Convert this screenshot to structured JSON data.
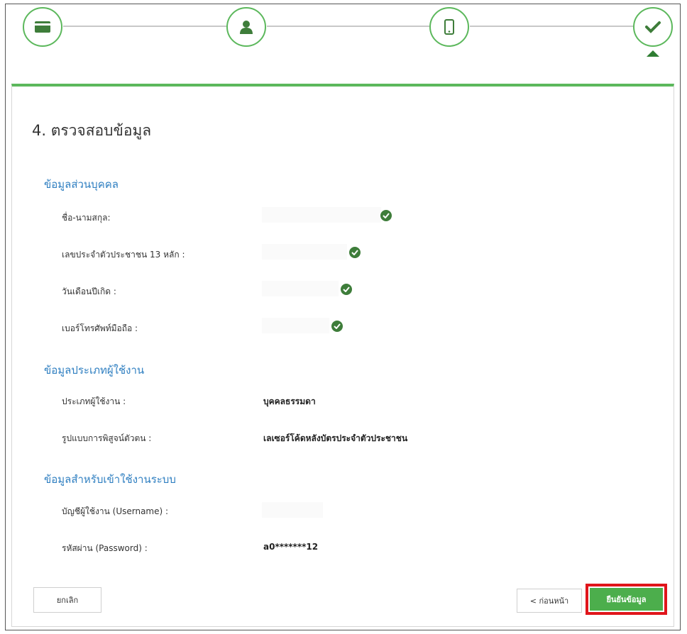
{
  "stepper": {
    "steps": [
      {
        "icon": "credit-card-icon"
      },
      {
        "icon": "user-icon"
      },
      {
        "icon": "mobile-phone-icon"
      },
      {
        "icon": "checkmark-icon",
        "active": true
      }
    ],
    "accent_color": "#5cb85c"
  },
  "page_title": "4. ตรวจสอบข้อมูล",
  "sections": {
    "personal": {
      "title": "ข้อมูลส่วนบุคคล",
      "name_label": "ชื่อ-นามสกุล:",
      "id_label": "เลขประจำตัวประชาชน 13 หลัก :",
      "birth_label": "วันเดือนปีเกิด :",
      "phone_label": "เบอร์โทรศัพท์มือถือ :"
    },
    "user_type": {
      "title": "ข้อมูลประเภทผู้ใช้งาน",
      "type_label": "ประเภทผู้ใช้งาน :",
      "type_value": "บุคคลธรรมดา",
      "verify_label": "รูปแบบการพิสูจน์ตัวตน :",
      "verify_value": "เลเซอร์โค้ดหลังบัตรประจำตัวประชาชน"
    },
    "login": {
      "title": "ข้อมูลสำหรับเข้าใช้งานระบบ",
      "username_label": "บัญชีผู้ใช้งาน (Username) :",
      "password_label": "รหัสผ่าน (Password) :",
      "password_value": "a0*******12"
    }
  },
  "buttons": {
    "cancel": "ยกเลิก",
    "back": "< ก่อนหน้า",
    "confirm": "ยืนยันข้อมูล"
  },
  "colors": {
    "section_title": "#2f7fc1",
    "check": "#3e7d3a",
    "confirm_button": "#4cae4c",
    "highlight_border": "#e0151b"
  }
}
